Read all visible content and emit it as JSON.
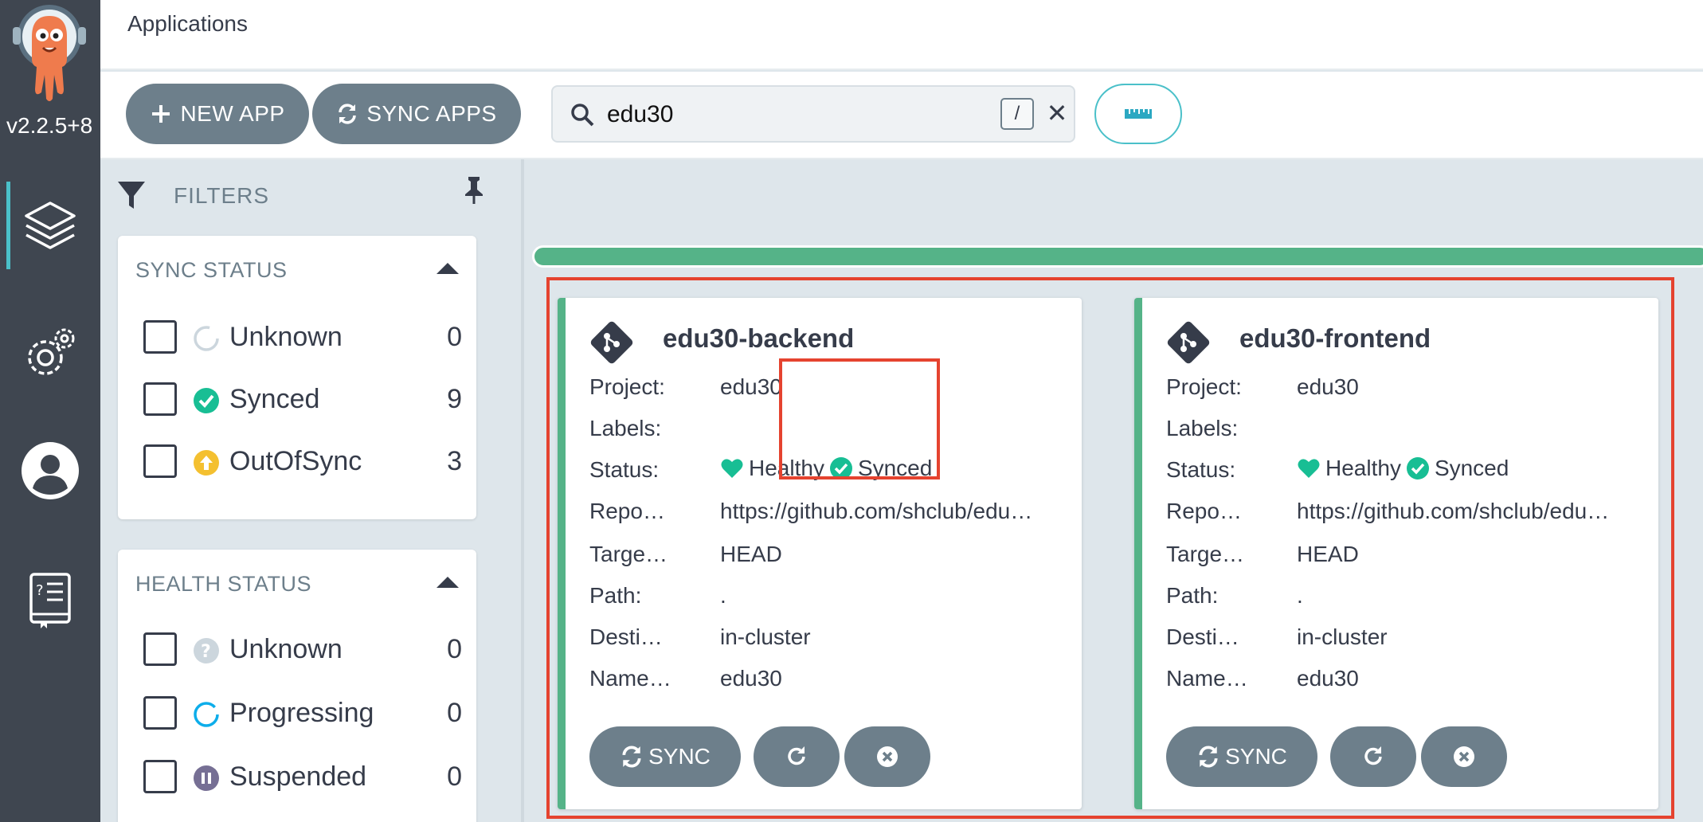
{
  "nav": {
    "version": "v2.2.5+8",
    "items": [
      {
        "name": "applications",
        "active": true
      },
      {
        "name": "settings",
        "active": false
      },
      {
        "name": "user",
        "active": false
      },
      {
        "name": "docs",
        "active": false
      }
    ]
  },
  "header": {
    "title": "Applications"
  },
  "toolbar": {
    "new_app_label": "NEW APP",
    "sync_apps_label": "SYNC APPS",
    "search_value": "edu30",
    "search_shortcut": "/",
    "clear_symbol": "✕"
  },
  "filters": {
    "label": "FILTERS",
    "sync_status": {
      "title": "SYNC STATUS",
      "items": [
        {
          "label": "Unknown",
          "count": "0",
          "icon": "circle-notch-icon",
          "color": "#ccd6dd"
        },
        {
          "label": "Synced",
          "count": "9",
          "icon": "check-circle-icon",
          "color": "#18be94"
        },
        {
          "label": "OutOfSync",
          "count": "3",
          "icon": "arrow-up-circle-icon",
          "color": "#f4c030"
        }
      ]
    },
    "health_status": {
      "title": "HEALTH STATUS",
      "items": [
        {
          "label": "Unknown",
          "count": "0",
          "icon": "question-circle-icon",
          "color": "#ccd6dd"
        },
        {
          "label": "Progressing",
          "count": "0",
          "icon": "spinner-icon",
          "color": "#0dadea"
        },
        {
          "label": "Suspended",
          "count": "0",
          "icon": "pause-circle-icon",
          "color": "#766f94"
        }
      ]
    }
  },
  "colors": {
    "nav_bg": "#3f4650",
    "accent": "#4ac0c9",
    "healthy": "#18be94",
    "card_border": "#55b388",
    "button": "#6d7f8b",
    "selection": "#e5432f"
  },
  "apps": [
    {
      "name": "edu30-backend",
      "props": [
        {
          "label": "Project:",
          "value": "edu30"
        },
        {
          "label": "Labels:",
          "value": ""
        },
        {
          "label": "Status:",
          "health": "Healthy",
          "sync": "Synced"
        },
        {
          "label": "Repo…",
          "value": "https://github.com/shclub/edu…"
        },
        {
          "label": "Targe…",
          "value": "HEAD"
        },
        {
          "label": "Path:",
          "value": "."
        },
        {
          "label": "Desti…",
          "value": "in-cluster"
        },
        {
          "label": "Name…",
          "value": "edu30"
        }
      ],
      "sync_label": "SYNC"
    },
    {
      "name": "edu30-frontend",
      "props": [
        {
          "label": "Project:",
          "value": "edu30"
        },
        {
          "label": "Labels:",
          "value": ""
        },
        {
          "label": "Status:",
          "health": "Healthy",
          "sync": "Synced"
        },
        {
          "label": "Repo…",
          "value": "https://github.com/shclub/edu…"
        },
        {
          "label": "Targe…",
          "value": "HEAD"
        },
        {
          "label": "Path:",
          "value": "."
        },
        {
          "label": "Desti…",
          "value": "in-cluster"
        },
        {
          "label": "Name…",
          "value": "edu30"
        }
      ],
      "sync_label": "SYNC"
    }
  ]
}
